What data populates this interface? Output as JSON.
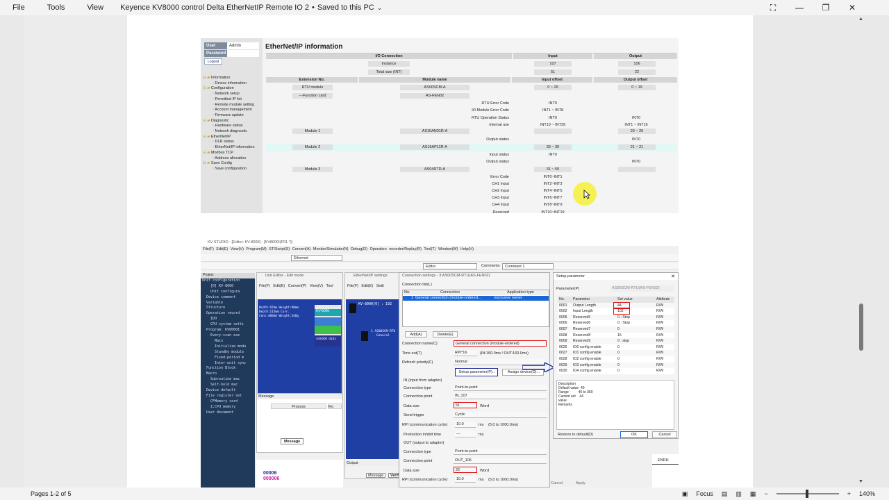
{
  "window": {
    "menu": [
      "File",
      "Tools",
      "View"
    ],
    "doc_title": "Keyence KV8000 control Delta EtherNetIP Remote IO 2",
    "save_state": "Saved to this PC",
    "controls": {
      "crop": "⛶",
      "minimize": "—",
      "maximize": "❐",
      "close": "✕"
    }
  },
  "statusbar": {
    "pages": "Pages 1-2 of 5",
    "focus": "Focus",
    "zoom": "140%",
    "minus": "−",
    "plus": "+"
  },
  "eip": {
    "login": {
      "user_label": "User",
      "user_value": "Admin",
      "password_label": "Password",
      "logout": "Logout"
    },
    "tree": [
      {
        "label": "Information",
        "children": [
          "Device information"
        ]
      },
      {
        "label": "Configuration",
        "children": [
          "Network setup",
          "Permitted IP list",
          "Remote module setting",
          "Account management",
          "Firmware update"
        ]
      },
      {
        "label": "Diagnostic",
        "children": [
          "Hardware status",
          "Network diagnostic"
        ]
      },
      {
        "label": "EtherNet/IP",
        "children": [
          "DLR status",
          "EtherNet/IP information"
        ]
      },
      {
        "label": "Modbus TCP",
        "children": [
          "Address allocation"
        ]
      },
      {
        "label": "Save Config",
        "children": [
          "Save configuration"
        ]
      }
    ],
    "title": "EtherNet/IP information",
    "io_connection_header": "I/O Connection",
    "input_header": "Input",
    "output_header": "Output",
    "instance_label": "Instance",
    "instance_in": "107",
    "instance_out": "106",
    "total_label": "Total size (INT)",
    "total_in": "51",
    "total_out": "22",
    "ext_header": "Extension No.",
    "module_header": "Module name",
    "in_offset_header": "Input offset",
    "out_offset_header": "Output offset",
    "rtu_label": "RTU module",
    "rtu_name": "AS00SCM-A",
    "rtu_in": "0 ~ 29",
    "rtu_out": "0 ~ 19",
    "fc_label": "---Function card",
    "fc_name": "AS-FEN02",
    "rtu_details": [
      {
        "k": "RTU Error Code",
        "in": "INT0",
        "out": ""
      },
      {
        "k": "IO Module Error Code",
        "in": "INT1 ~ INT8",
        "out": ""
      },
      {
        "k": "RTU Operation Status",
        "in": "INT9",
        "out": "INT0"
      },
      {
        "k": "Internal use",
        "in": "INT10 ~ INT29",
        "out": "INT1 ~ INT19"
      }
    ],
    "m1_label": "Module 1",
    "m1_name": "AS16AN01R-A",
    "m1_out": "20 ~ 20",
    "m1_status": "Output status",
    "m1_status_out": "INT0",
    "m2_label": "Module 2",
    "m2_name": "AS16AP11R-A",
    "m2_in": "30 ~ 30",
    "m2_out": "21 ~ 21",
    "m2_in_status": "Input status",
    "m2_in_status_v": "INT0",
    "m2_out_status": "Output status",
    "m2_out_status_v": "INT0",
    "m3_label": "Module 3",
    "m3_name": "AS04RTD-A",
    "m3_in": "31 ~ 50",
    "m3_details": [
      {
        "k": "Error Code",
        "in": "INT0~INT1"
      },
      {
        "k": "CH1 Input",
        "in": "INT2~INT3"
      },
      {
        "k": "CH2 Input",
        "in": "INT4~INT5"
      },
      {
        "k": "CH3 Input",
        "in": "INT6~INT7"
      },
      {
        "k": "CH4 Input",
        "in": "INT8~INT9"
      },
      {
        "k": "Reserved",
        "in": "INT10~INT19"
      }
    ]
  },
  "kv": {
    "title": "KV STUDIO - [Editor: KV-8000] - [KV8000I(P01 *)]",
    "menu": "File(F) Edit(E) View(V) Program(M) ST/Script(S) Convert(A) Monitor/Simulator(N) Debug(D) Operation recorder/Replay(R) Tool(T) Window(W) Help(H)",
    "tb_ethernet": "Ethernet",
    "tb_editor": "Editor",
    "tb_comments": "Comments",
    "tb_comment1": "Comment 1",
    "project_header": "Project",
    "project_tree": [
      "Unit configuration",
      "[0] KV-8000",
      "Unit configura",
      "Device comment",
      "Variable",
      "Structure",
      "Operation record",
      "IDO",
      "CPU system setti",
      "Program: KV8000I",
      "Every-scan exe",
      "Main",
      "Initialize modu",
      "Standby module",
      "Fixed-period m",
      "Inter-unit sync",
      "Function Block",
      "Macro",
      "Subroutine mac",
      "Self-hold mac",
      "Device default",
      "File register set",
      "CFMemory card",
      "1:CPU memory",
      "User document"
    ],
    "unit_editor_title": "Unit Editor - Edit mode",
    "unit_menu": "File(F) Edit(E) Convert(P) View(V) Tool",
    "unit_label": "KV-8000",
    "unit_info": "Width:97mm Height:90mm Depth:115mm Curr. Cons:400mA Weight:340g",
    "unit_code": "AS0000 -3151",
    "eip_settings_title": "EtherNet/IP settings",
    "eip_menu": "File(F) Edit(E) Setti",
    "eip_node": "KV-8000[0] : 192",
    "eip_child": "1 AS00SCM-RTU",
    "eip_general": "General",
    "message_title": "Message",
    "message_col1": "Process",
    "message_col2": "Ro",
    "message_tab": "Message",
    "output_title": "Output",
    "output_tab1": "Message",
    "output_tab2": "Verif",
    "ladder_num1": "00006",
    "ladder_num2": "000006",
    "conn_title": "Connection settings - 3:AS00SCM-RTU(AS-FEN02)",
    "conn_list": "Connection list(L)",
    "conn_hdr_no": "No.",
    "conn_hdr_conn": "Connection",
    "conn_hdr_app": "Application type",
    "conn_row_no": "1",
    "conn_row_conn": "General connection (module-ordered...",
    "conn_row_app": "Exclusive owner",
    "add": "Add(A)",
    "delete": "Delete(E)",
    "fields": {
      "conn_name_l": "Connection name(C)",
      "conn_name_v": "General connection (module-ordered)",
      "timeout_l": "Time out(T)",
      "timeout_v": "RPI*16",
      "timeout_note": "(IN:160.0ms / OUT:160.0ms)",
      "refresh_l": "Refresh priority(F)",
      "refresh_v": "Normal",
      "setup_btn": "Setup parameter(P)...",
      "assign_btn": "Assign device(D)...",
      "in_hdr": "IN (input from adapter)",
      "ctype_l": "Connection type",
      "ctype_v": "Point-to-point",
      "cpoint_l": "Connection point",
      "cpoint_v": "IN_107",
      "dsize_l": "Data size",
      "dsize_v": "51",
      "word": "Word",
      "trigger_l": "Send trigger",
      "trigger_v": "Cyclic",
      "rpi_l": "RPI (communication cycle)",
      "rpi_v": "10.0",
      "ms": "ms",
      "rpi_note": "(5.0 to 1000.0ms)",
      "inhibit_l": "Production inhibit time",
      "inhibit_v": "---",
      "out_hdr": "OUT (output to adapter)",
      "octype_l": "Connection type",
      "octype_v": "Point-to-point",
      "ocpoint_l": "Connection point",
      "ocpoint_v": "OUT_106",
      "odsize_l": "Data size",
      "odsize_v": "22",
      "orpi_l": "RPI (communication cycle)",
      "orpi_v": "10.0"
    },
    "setup_title": "Setup parameter",
    "param_label": "Parameter(P)",
    "param_value": "AS00SCM-RTU(AS-FEN02)",
    "ptbl_hdr": [
      "No.",
      "Parameter",
      "Set value",
      "Attribute"
    ],
    "params": [
      [
        "0001",
        "Output Length",
        "44",
        "R/W"
      ],
      [
        "0002",
        "Input Length",
        "102",
        "R/W"
      ],
      [
        "0005",
        "Reserved5",
        "0 : Stop",
        "R/W"
      ],
      [
        "0006",
        "Reserved6",
        "0 : Stop",
        "R/W"
      ],
      [
        "0007",
        "Reserved7",
        "0",
        "R/W"
      ],
      [
        "0008",
        "Reserved8",
        "15",
        "R/W"
      ],
      [
        "0009",
        "Reserved9",
        "0 : stop",
        "R/W"
      ],
      [
        "0026",
        "IO0 config enable",
        "0",
        "R/W"
      ],
      [
        "0027",
        "IO1 config enable",
        "0",
        "R/W"
      ],
      [
        "0028",
        "IO2 config enable",
        "0",
        "R/W"
      ],
      [
        "0029",
        "IO3 config enable",
        "0",
        "R/W"
      ],
      [
        "0030",
        "IO4 config enable",
        "0",
        "R/W"
      ]
    ],
    "desc_title": "Description",
    "desc_lines": [
      "Default value  40",
      "Range          40 to 360",
      "Current set    44",
      "value",
      "Remarks"
    ],
    "restore": "Restore to default(D)",
    "ok": "OK",
    "cancel": "Cancel",
    "endh": "ENDH",
    "cancel_small": "Cancel",
    "apply_small": "Apply"
  },
  "colors": {
    "highlight_red": "#d11111",
    "highlight_blue": "#1a2aa0",
    "cursor_yellow": "#f6f140"
  }
}
